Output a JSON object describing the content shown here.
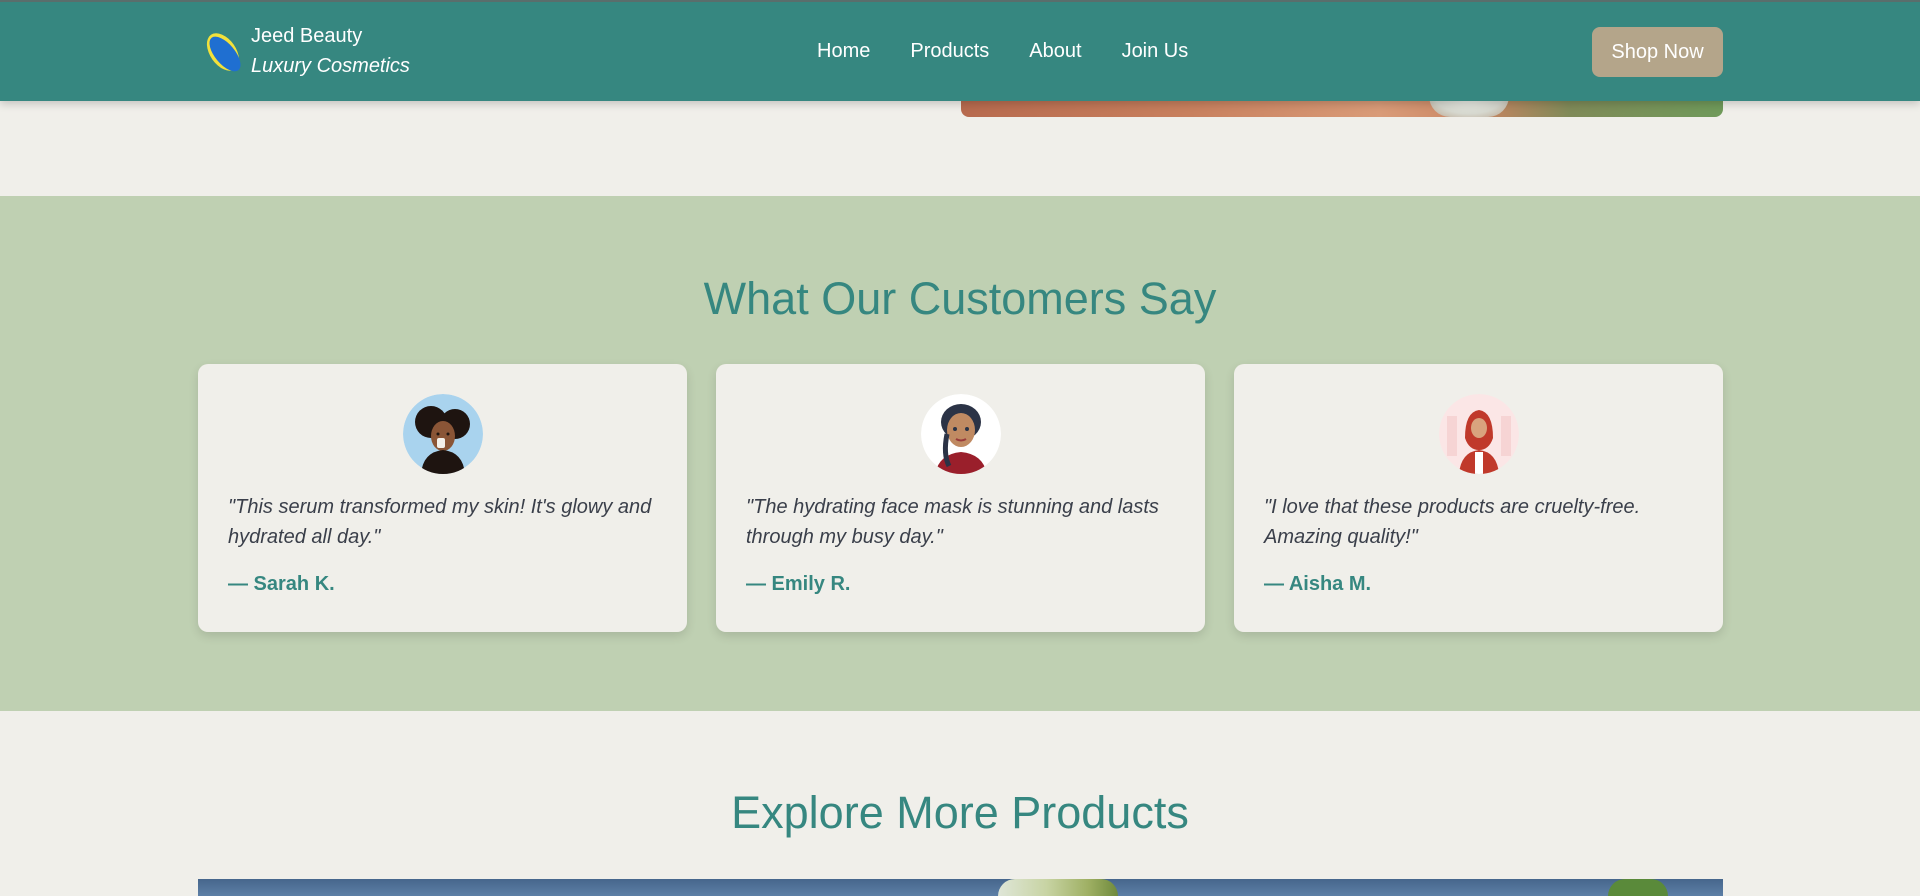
{
  "header": {
    "brand_name": "Jeed Beauty",
    "brand_tagline": "Luxury Cosmetics",
    "nav": [
      "Home",
      "Products",
      "About",
      "Join Us"
    ],
    "cta_label": "Shop Now"
  },
  "testimonials": {
    "title": "What Our Customers Say",
    "items": [
      {
        "quote": "\"This serum transformed my skin! It's glowy and hydrated all day.\"",
        "author": "— Sarah K."
      },
      {
        "quote": "\"The hydrating face mask is stunning and lasts through my busy day.\"",
        "author": "— Emily R."
      },
      {
        "quote": "\"I love that these products are cruelty-free. Amazing quality!\"",
        "author": "— Aisha M."
      }
    ]
  },
  "explore": {
    "title": "Explore More Products"
  },
  "colors": {
    "primary": "#368780",
    "testimonial_bg": "#bfd0b2",
    "page_bg": "#f0efea",
    "cta_bg": "#b4a58a"
  }
}
